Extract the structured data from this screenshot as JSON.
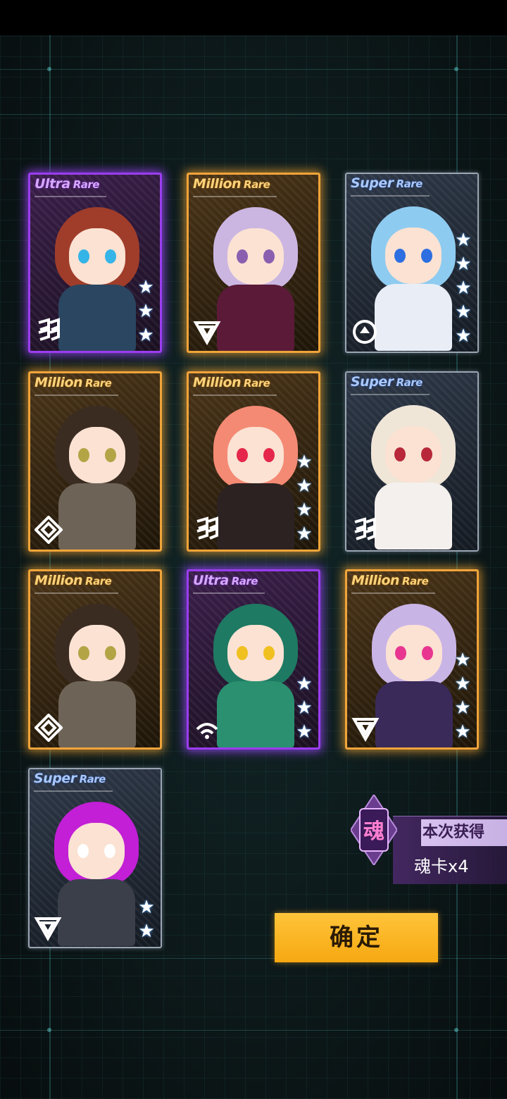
{
  "cards": [
    {
      "rarity_main": "Ultra",
      "rarity_sub": "Rare",
      "tier": "ur",
      "stars": 3,
      "class_icon": "dual-slash-icon",
      "hair_color": "#a03d2a",
      "eye_color": "#35b4e8",
      "outfit_color": "#2a4660"
    },
    {
      "rarity_main": "Million",
      "rarity_sub": "Rare",
      "tier": "mr",
      "stars": 0,
      "class_icon": "triangle-emblem-icon",
      "hair_color": "#cbb6e2",
      "eye_color": "#8a5fb0",
      "outfit_color": "#5a1a38"
    },
    {
      "rarity_main": "Super",
      "rarity_sub": "Rare",
      "tier": "sr",
      "stars": 5,
      "class_icon": "circle-emblem-icon",
      "hair_color": "#8ecbf0",
      "eye_color": "#2d6fe0",
      "outfit_color": "#e9eef6"
    },
    {
      "rarity_main": "Million",
      "rarity_sub": "Rare",
      "tier": "mr",
      "stars": 0,
      "class_icon": "diamond-emblem-icon",
      "hair_color": "#3b2c22",
      "eye_color": "#b3a446",
      "outfit_color": "#6e6357"
    },
    {
      "rarity_main": "Million",
      "rarity_sub": "Rare",
      "tier": "mr",
      "stars": 4,
      "class_icon": "dual-slash-icon",
      "hair_color": "#f48a74",
      "eye_color": "#e4274a",
      "outfit_color": "#2c2222"
    },
    {
      "rarity_main": "Super",
      "rarity_sub": "Rare",
      "tier": "sr",
      "stars": 0,
      "class_icon": "dual-slash-icon",
      "hair_color": "#efe6d8",
      "eye_color": "#b8283a",
      "outfit_color": "#f4f0ee"
    },
    {
      "rarity_main": "Million",
      "rarity_sub": "Rare",
      "tier": "mr",
      "stars": 0,
      "class_icon": "diamond-emblem-icon",
      "hair_color": "#3b2c22",
      "eye_color": "#b3a446",
      "outfit_color": "#6e6357"
    },
    {
      "rarity_main": "Ultra",
      "rarity_sub": "Rare",
      "tier": "ur",
      "stars": 3,
      "class_icon": "signal-emblem-icon",
      "hair_color": "#1e7a62",
      "eye_color": "#f0c020",
      "outfit_color": "#2a9070"
    },
    {
      "rarity_main": "Million",
      "rarity_sub": "Rare",
      "tier": "mr",
      "stars": 4,
      "class_icon": "triangle-emblem-icon",
      "hair_color": "#c9b4e6",
      "eye_color": "#e83690",
      "outfit_color": "#3a2a5a"
    },
    {
      "rarity_main": "Super",
      "rarity_sub": "Rare",
      "tier": "sr",
      "stars": 2,
      "class_icon": "triangle-emblem-icon",
      "hair_color": "#c21fd6",
      "eye_color": "#ffffff",
      "outfit_color": "#3a3f4a"
    }
  ],
  "reward": {
    "badge_char": "魂",
    "title": "本次获得",
    "count": "魂卡x4"
  },
  "confirm_label": "确定"
}
